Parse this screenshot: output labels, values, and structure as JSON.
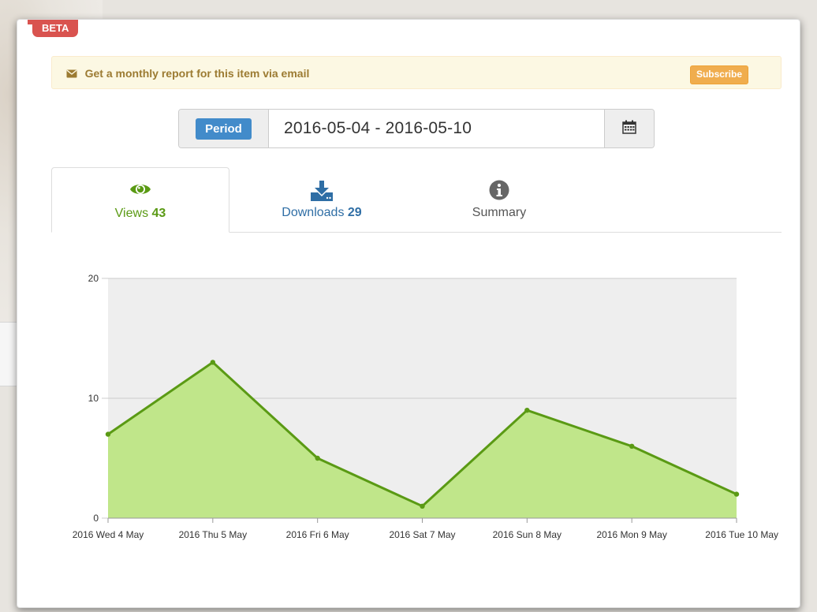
{
  "badge": {
    "beta_label": "BETA"
  },
  "alert": {
    "message": "Get a monthly report for this item via email",
    "subscribe_label": "Subscribe"
  },
  "period": {
    "label": "Period",
    "value": "2016-05-04 - 2016-05-10"
  },
  "tabs": [
    {
      "label": "Views",
      "count": "43",
      "icon": "eye-icon",
      "color": "#5a9a14",
      "active": true
    },
    {
      "label": "Downloads",
      "count": "29",
      "icon": "download-icon",
      "color": "#2f6ea5",
      "active": false
    },
    {
      "label": "Summary",
      "count": "",
      "icon": "info-icon",
      "color": "#666666",
      "active": false
    }
  ],
  "colors": {
    "area_fill": "#c0e68a",
    "line": "#5a9a14",
    "plot_bg": "#eeeeee",
    "grid": "#cccccc"
  },
  "chart_data": {
    "type": "area",
    "categories": [
      "2016 Wed 4 May",
      "2016 Thu 5 May",
      "2016 Fri 6 May",
      "2016 Sat 7 May",
      "2016 Sun 8 May",
      "2016 Mon 9 May",
      "2016 Tue 10 May"
    ],
    "series": [
      {
        "values": [
          7,
          13,
          5,
          1,
          9,
          6,
          2
        ]
      }
    ],
    "yticks": [
      0,
      10,
      20
    ],
    "ylim": [
      0,
      20
    ],
    "grid": true,
    "title": "",
    "xlabel": "",
    "ylabel": ""
  }
}
